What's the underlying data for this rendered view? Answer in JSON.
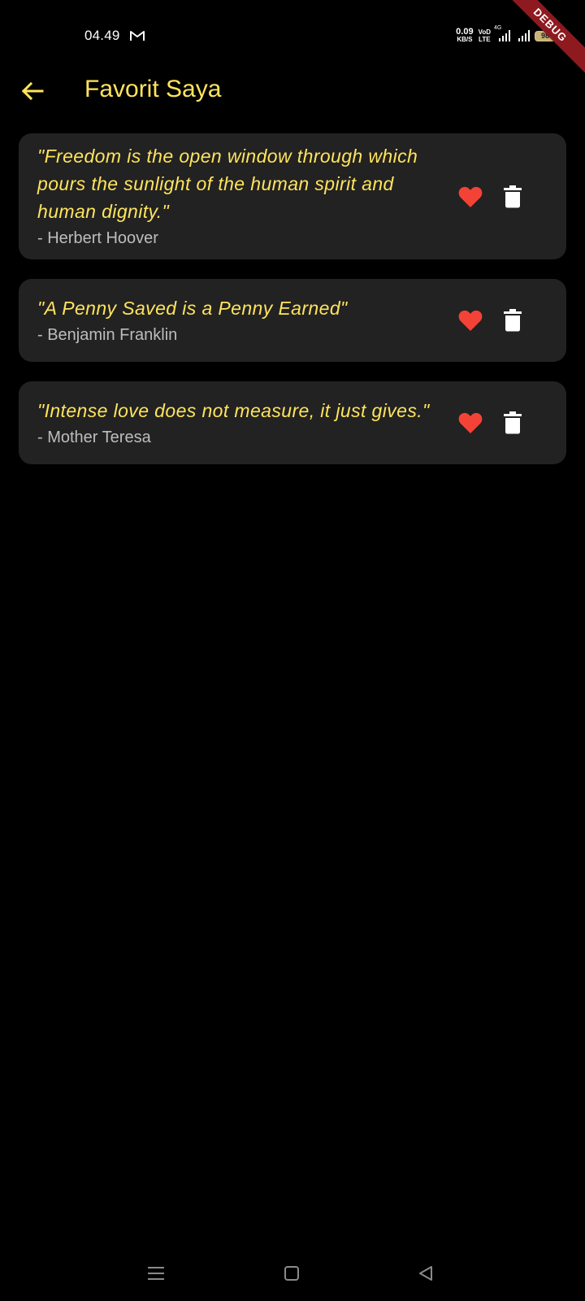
{
  "status_bar": {
    "time": "04.49",
    "net_speed_value": "0.09",
    "net_speed_unit": "KB/S",
    "volte_top": "VoD",
    "volte_bottom": "LTE",
    "network_type": "4G",
    "battery_level": "98",
    "icons": [
      "mail-icon",
      "signal-icon",
      "battery-icon",
      "charging-icon"
    ]
  },
  "debug_banner": "DEBUG",
  "app_bar": {
    "back_icon": "arrow-left-icon",
    "title": "Favorit Saya"
  },
  "quotes": [
    {
      "text": "\"Freedom is the open window through which pours the sunlight of the human spirit and human dignity.\"",
      "author": "- Herbert Hoover"
    },
    {
      "text": "\"A Penny Saved is a Penny Earned\"",
      "author": "- Benjamin Franklin"
    },
    {
      "text": "\"Intense love does not measure, it just gives.\"",
      "author": "- Mother Teresa"
    }
  ],
  "colors": {
    "background": "#000000",
    "card": "#222222",
    "accent_yellow": "#ffe45c",
    "author_gray": "#bdbdbd",
    "heart_red": "#f44336",
    "icon_white": "#ffffff",
    "debug_red": "#8e1a1f"
  },
  "nav_bar": {
    "icons": [
      "menu-icon",
      "home-square-icon",
      "back-triangle-icon"
    ]
  }
}
